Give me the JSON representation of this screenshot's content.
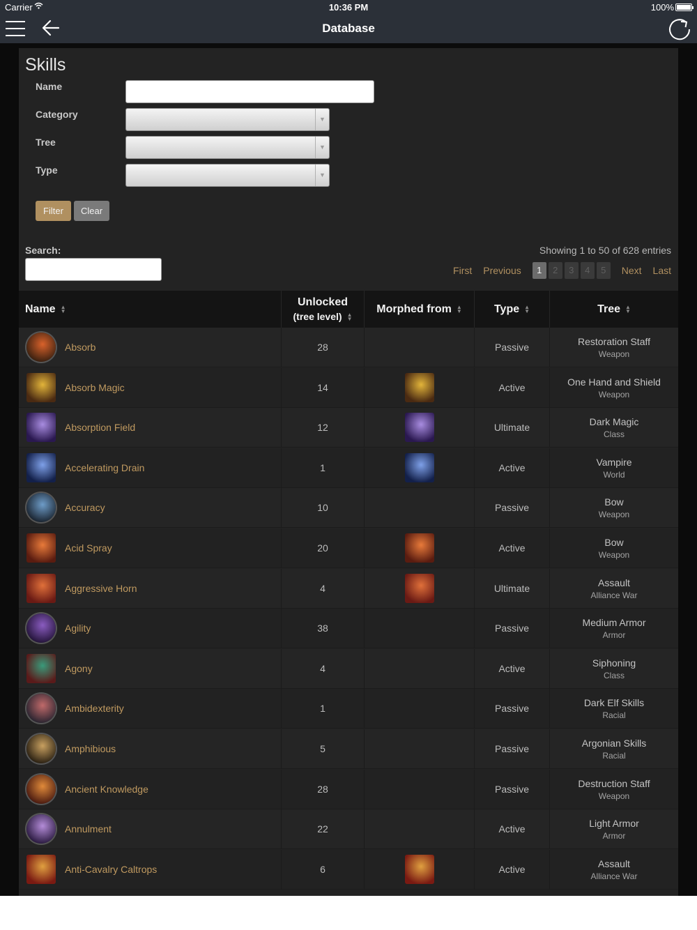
{
  "status_bar": {
    "carrier": "Carrier",
    "time": "10:36 PM",
    "battery": "100%"
  },
  "nav": {
    "title": "Database"
  },
  "page": {
    "title": "Skills"
  },
  "filters": {
    "name_label": "Name",
    "name_value": "",
    "category_label": "Category",
    "category_value": "",
    "tree_label": "Tree",
    "tree_value": "",
    "type_label": "Type",
    "type_value": "",
    "filter_button": "Filter",
    "clear_button": "Clear"
  },
  "search": {
    "label": "Search:",
    "value": ""
  },
  "entries_info": "Showing 1 to 50 of 628 entries",
  "pagination": {
    "first": "First",
    "previous": "Previous",
    "pages": [
      "1",
      "2",
      "3",
      "4",
      "5"
    ],
    "current": "1",
    "next": "Next",
    "last": "Last"
  },
  "columns": {
    "name": "Name",
    "unlocked_line1": "Unlocked",
    "unlocked_line2": "(tree level)",
    "morphed_from": "Morphed from",
    "type": "Type",
    "tree": "Tree"
  },
  "rows": [
    {
      "name": "Absorb",
      "unlocked": "28",
      "type": "Passive",
      "tree": "Restoration Staff",
      "tree_type": "Weapon",
      "morph": false,
      "icon": "absorb-icon",
      "c1": "#d9622b",
      "c2": "#3a2010"
    },
    {
      "name": "Absorb Magic",
      "unlocked": "14",
      "type": "Active",
      "tree": "One Hand and Shield",
      "tree_type": "Weapon",
      "morph": true,
      "icon": "absorb-magic-icon",
      "c1": "#e2b43a",
      "c2": "#4a2a12"
    },
    {
      "name": "Absorption Field",
      "unlocked": "12",
      "type": "Ultimate",
      "tree": "Dark Magic",
      "tree_type": "Class",
      "morph": true,
      "icon": "absorption-field-icon",
      "c1": "#a88ce0",
      "c2": "#2a1850"
    },
    {
      "name": "Accelerating Drain",
      "unlocked": "1",
      "type": "Active",
      "tree": "Vampire",
      "tree_type": "World",
      "morph": true,
      "icon": "accelerating-drain-icon",
      "c1": "#7ea0e8",
      "c2": "#13204a"
    },
    {
      "name": "Accuracy",
      "unlocked": "10",
      "type": "Passive",
      "tree": "Bow",
      "tree_type": "Weapon",
      "morph": false,
      "icon": "accuracy-icon",
      "c1": "#6e9cc8",
      "c2": "#1a2430"
    },
    {
      "name": "Acid Spray",
      "unlocked": "20",
      "type": "Active",
      "tree": "Bow",
      "tree_type": "Weapon",
      "morph": true,
      "icon": "acid-spray-icon",
      "c1": "#e87a3a",
      "c2": "#5a1c10"
    },
    {
      "name": "Aggressive Horn",
      "unlocked": "4",
      "type": "Ultimate",
      "tree": "Assault",
      "tree_type": "Alliance War",
      "morph": true,
      "icon": "aggressive-horn-icon",
      "c1": "#e0703a",
      "c2": "#6a1a14"
    },
    {
      "name": "Agility",
      "unlocked": "38",
      "type": "Passive",
      "tree": "Medium Armor",
      "tree_type": "Armor",
      "morph": false,
      "icon": "agility-icon",
      "c1": "#8a5cc0",
      "c2": "#24143a"
    },
    {
      "name": "Agony",
      "unlocked": "4",
      "type": "Active",
      "tree": "Siphoning",
      "tree_type": "Class",
      "morph": false,
      "icon": "agony-icon",
      "c1": "#3a9a7a",
      "c2": "#5a1a1a"
    },
    {
      "name": "Ambidexterity",
      "unlocked": "1",
      "type": "Passive",
      "tree": "Dark Elf Skills",
      "tree_type": "Racial",
      "morph": false,
      "icon": "ambidexterity-icon",
      "c1": "#c06a6a",
      "c2": "#2a2430"
    },
    {
      "name": "Amphibious",
      "unlocked": "5",
      "type": "Passive",
      "tree": "Argonian Skills",
      "tree_type": "Racial",
      "morph": false,
      "icon": "amphibious-icon",
      "c1": "#c8a060",
      "c2": "#2a2012"
    },
    {
      "name": "Ancient Knowledge",
      "unlocked": "28",
      "type": "Passive",
      "tree": "Destruction Staff",
      "tree_type": "Weapon",
      "morph": false,
      "icon": "ancient-knowledge-icon",
      "c1": "#e08a3a",
      "c2": "#4a1a10"
    },
    {
      "name": "Annulment",
      "unlocked": "22",
      "type": "Active",
      "tree": "Light Armor",
      "tree_type": "Armor",
      "morph": false,
      "icon": "annulment-icon",
      "c1": "#b48cd8",
      "c2": "#2a1a40"
    },
    {
      "name": "Anti-Cavalry Caltrops",
      "unlocked": "6",
      "type": "Active",
      "tree": "Assault",
      "tree_type": "Alliance War",
      "morph": true,
      "icon": "anti-cavalry-caltrops-icon",
      "c1": "#e0a040",
      "c2": "#7a1a12"
    }
  ],
  "colors": {
    "link": "#c09a60",
    "filter_button": "#b09060",
    "nav_bar": "#2b3038"
  }
}
